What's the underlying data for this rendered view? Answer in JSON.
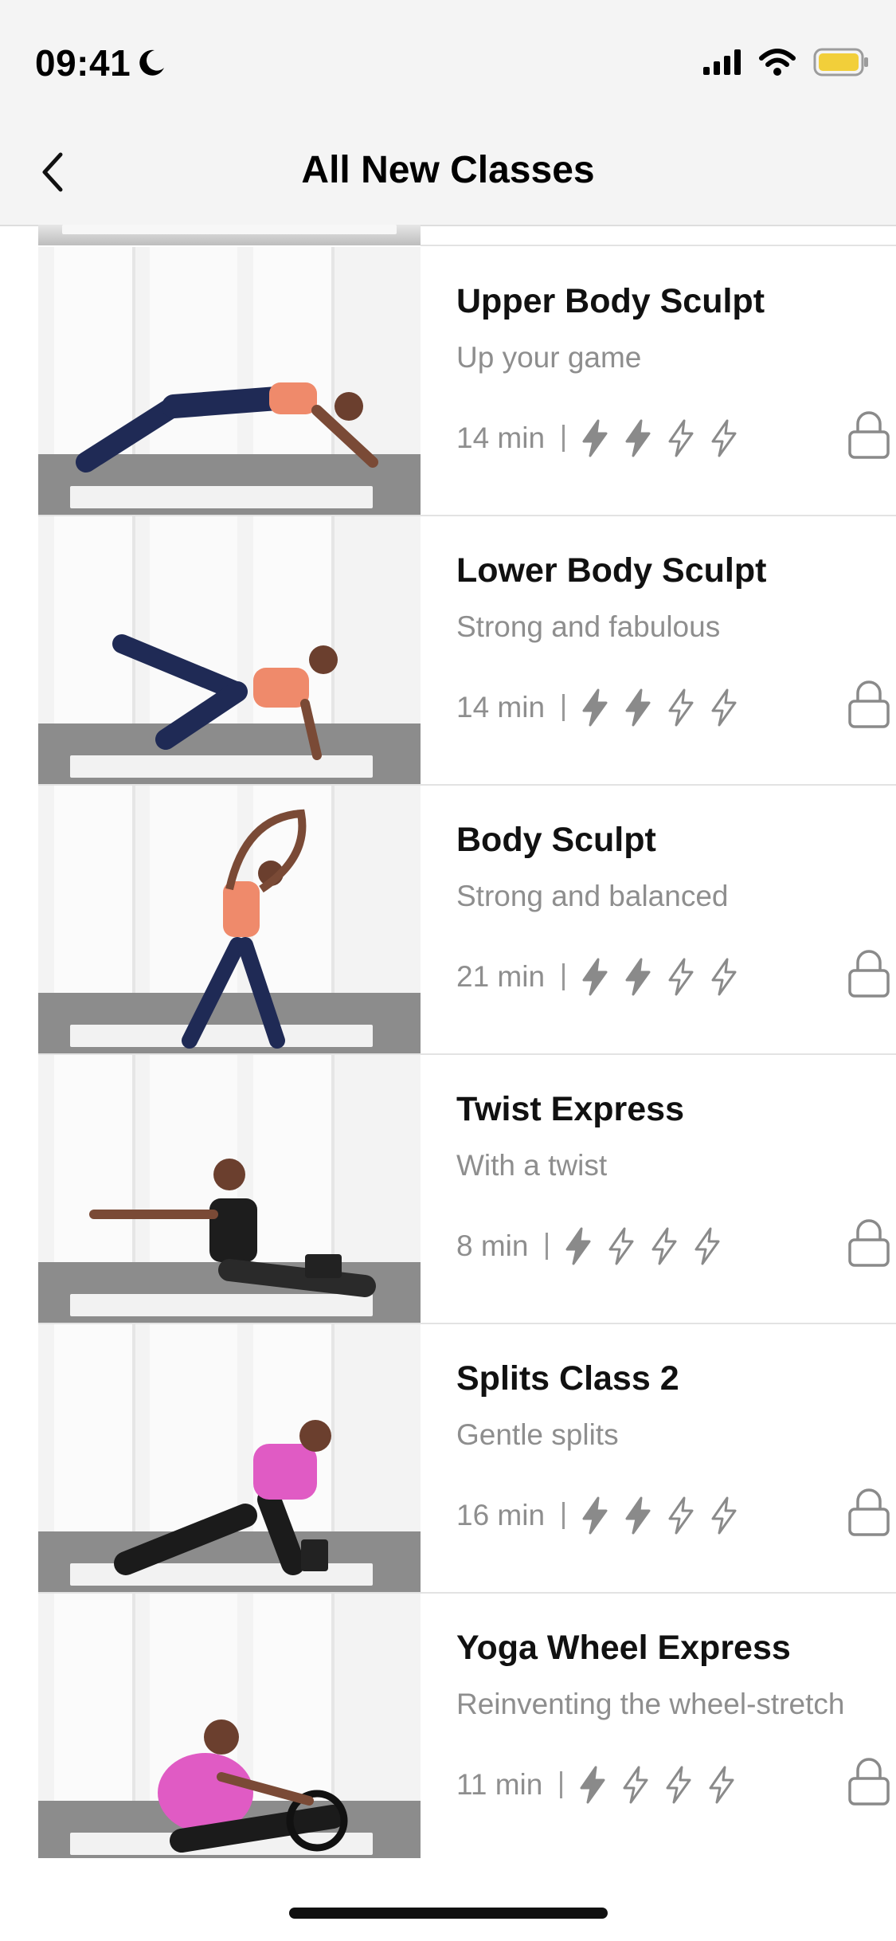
{
  "status_bar": {
    "time": "09:41",
    "icons": [
      "moon-icon",
      "cellular-signal-icon",
      "wifi-icon",
      "battery-icon"
    ],
    "battery_color": "#f2cf3a"
  },
  "header": {
    "title": "All New Classes",
    "back_icon": "chevron-left-icon"
  },
  "classes": [
    {
      "title": "Upper Body Sculpt",
      "subtitle": "Up your game",
      "duration": "14 min",
      "intensity": 2,
      "max_intensity": 4,
      "locked": true,
      "top_color": "#ef8a6b"
    },
    {
      "title": "Lower Body Sculpt",
      "subtitle": "Strong and fabulous",
      "duration": "14 min",
      "intensity": 2,
      "max_intensity": 4,
      "locked": true,
      "top_color": "#ef8a6b"
    },
    {
      "title": "Body Sculpt",
      "subtitle": "Strong and balanced",
      "duration": "21 min",
      "intensity": 2,
      "max_intensity": 4,
      "locked": true,
      "top_color": "#ef8a6b"
    },
    {
      "title": "Twist Express",
      "subtitle": "With a twist",
      "duration": "8 min",
      "intensity": 1,
      "max_intensity": 4,
      "locked": true,
      "top_color": "#1d1d1d"
    },
    {
      "title": "Splits Class 2",
      "subtitle": "Gentle splits",
      "duration": "16 min",
      "intensity": 2,
      "max_intensity": 4,
      "locked": true,
      "top_color": "#e05bc4"
    },
    {
      "title": "Yoga Wheel Express",
      "subtitle": "Reinventing the wheel-stretch",
      "duration": "11 min",
      "intensity": 1,
      "max_intensity": 4,
      "locked": true,
      "top_color": "#e05bc4"
    }
  ],
  "colors": {
    "title": "#111111",
    "subtitle": "#8e8e8e",
    "icon_grey": "#8a8a8a",
    "header_bg": "#f4f4f4"
  }
}
